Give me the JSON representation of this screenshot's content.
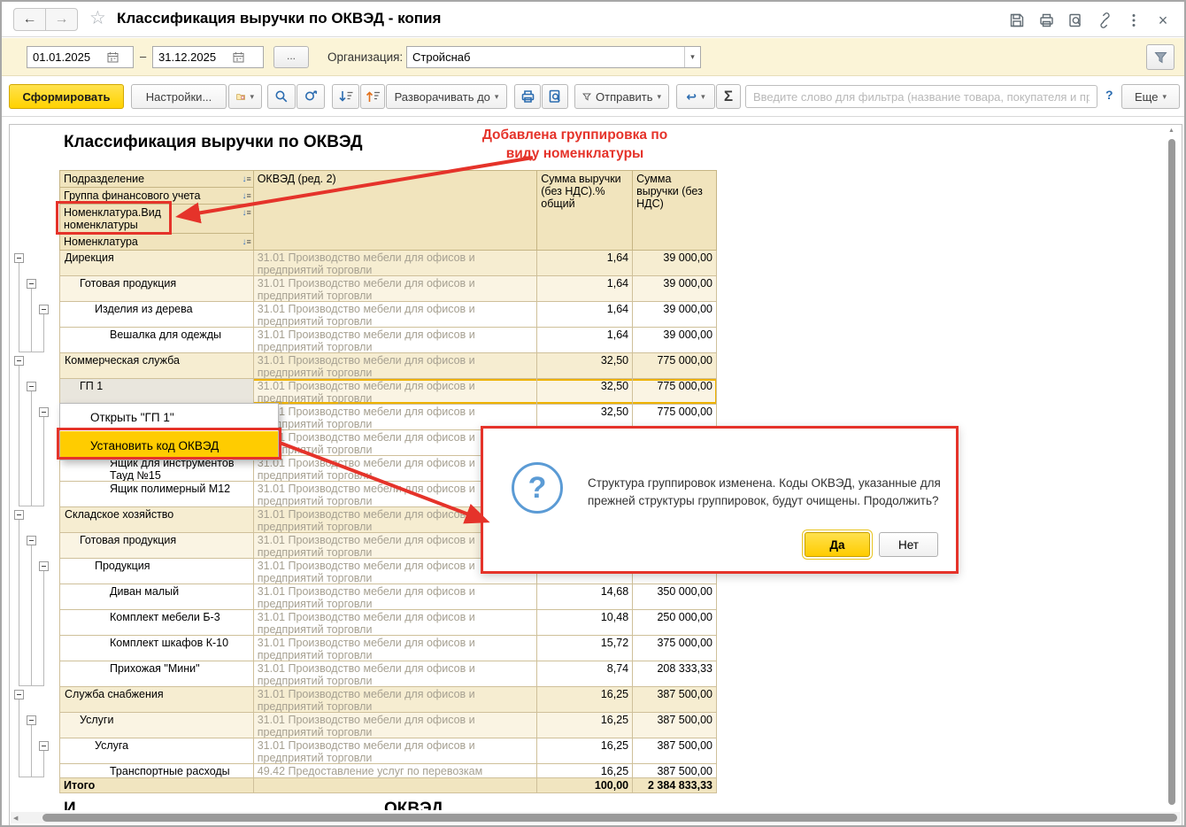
{
  "titlebar": {
    "title": "Классификация выручки по ОКВЭД - копия"
  },
  "filterbar": {
    "date_from": "01.01.2025",
    "range_dash": "–",
    "date_to": "31.12.2025",
    "period_more_label": "...",
    "org_label": "Организация:",
    "org_value": "Стройснаб"
  },
  "toolbar": {
    "generate_label": "Сформировать",
    "settings_label": "Настройки...",
    "expand_to_label": "Разворачивать до",
    "send_label": "Отправить",
    "sigma_label": "Σ",
    "filter_placeholder": "Введите слово для фильтра (название товара, покупателя и пр.)",
    "help_label": "?",
    "more_label": "Еще"
  },
  "report": {
    "title": "Классификация выручки по ОКВЭД",
    "annotation_line1": "Добавлена группировка по",
    "annotation_line2": "виду номенклатуры",
    "header": {
      "row_labels": [
        "Подразделение",
        "Группа финансового учета",
        "Номенклатура.Вид номенклатуры",
        "Номенклатура"
      ],
      "col_okved": "ОКВЭД (ред. 2)",
      "col_percent": "Сумма выручки (без НДС).% общий",
      "col_sum": "Сумма выручки (без НДС)"
    },
    "rows": [
      {
        "name": "Дирекция",
        "level": 0,
        "okved": "31.01 Производство мебели для офисов и предприятий торговли",
        "pct": "1,64",
        "sum": "39 000,00"
      },
      {
        "name": "Готовая продукция",
        "level": 1,
        "okved": "31.01 Производство мебели для офисов и предприятий торговли",
        "pct": "1,64",
        "sum": "39 000,00"
      },
      {
        "name": "Изделия из дерева",
        "level": 2,
        "okved": "31.01 Производство мебели для офисов и предприятий торговли",
        "pct": "1,64",
        "sum": "39 000,00"
      },
      {
        "name": "Вешалка для одежды",
        "level": 3,
        "okved": "31.01 Производство мебели для офисов и предприятий торговли",
        "pct": "1,64",
        "sum": "39 000,00"
      },
      {
        "name": "Коммерческая служба",
        "level": 0,
        "okved": "31.01 Производство мебели для офисов и предприятий торговли",
        "pct": "32,50",
        "sum": "775 000,00"
      },
      {
        "name": "ГП 1",
        "level": 1,
        "okved": "31.01 Производство мебели для офисов и предприятий торговли",
        "pct": "32,50",
        "sum": "775 000,00",
        "selected": true
      },
      {
        "name": "",
        "level": 2,
        "okved": "31.01 Производство мебели для офисов и предприятий торговли",
        "pct": "32,50",
        "sum": "775 000,00"
      },
      {
        "name": "",
        "level": 3,
        "okved": "31.01 Производство мебели для офисов и предприятий торговли",
        "pct": "",
        "sum": ""
      },
      {
        "name": "Ящик для инструментов Тауд №15",
        "level": 3,
        "okved": "31.01 Производство мебели для офисов и предприятий торговли",
        "pct": "",
        "sum": ""
      },
      {
        "name": "Ящик полимерный М12",
        "level": 3,
        "okved": "31.01 Производство мебели для офисов и предприятий торговли",
        "pct": "",
        "sum": ""
      },
      {
        "name": "Складское хозяйство",
        "level": 0,
        "okved": "31.01 Производство мебели для офисов и предприятий торговли",
        "pct": "",
        "sum": ""
      },
      {
        "name": "Готовая продукция",
        "level": 1,
        "okved": "31.01 Производство мебели для офисов и предприятий торговли",
        "pct": "",
        "sum": ""
      },
      {
        "name": "Продукция",
        "level": 2,
        "okved": "31.01 Производство мебели для офисов и предприятий торговли",
        "pct": "",
        "sum": ""
      },
      {
        "name": "Диван малый",
        "level": 3,
        "okved": "31.01 Производство мебели для офисов и предприятий торговли",
        "pct": "14,68",
        "sum": "350 000,00"
      },
      {
        "name": "Комплект мебели Б-3",
        "level": 3,
        "okved": "31.01 Производство мебели для офисов и предприятий торговли",
        "pct": "10,48",
        "sum": "250 000,00"
      },
      {
        "name": "Комплект шкафов К-10",
        "level": 3,
        "okved": "31.01 Производство мебели для офисов и предприятий торговли",
        "pct": "15,72",
        "sum": "375 000,00"
      },
      {
        "name": "Прихожая \"Мини\"",
        "level": 3,
        "okved": "31.01 Производство мебели для офисов и предприятий торговли",
        "pct": "8,74",
        "sum": "208 333,33"
      },
      {
        "name": "Служба снабжения",
        "level": 0,
        "okved": "31.01 Производство мебели для офисов и предприятий торговли",
        "pct": "16,25",
        "sum": "387 500,00"
      },
      {
        "name": "Услуги",
        "level": 1,
        "okved": "31.01 Производство мебели для офисов и предприятий торговли",
        "pct": "16,25",
        "sum": "387 500,00"
      },
      {
        "name": "Услуга",
        "level": 2,
        "okved": "31.01 Производство мебели для офисов и предприятий торговли",
        "pct": "16,25",
        "sum": "387 500,00"
      },
      {
        "name": "Транспортные расходы",
        "level": 3,
        "okved": "49.42 Предоставление услуг по перевозкам",
        "pct": "16,25",
        "sum": "387 500,00",
        "h": 16
      }
    ],
    "total": {
      "name": "Итого",
      "okved": "",
      "pct": "100,00",
      "sum": "2 384 833,33"
    },
    "clipped_next_left": "И",
    "clipped_next_right": "ОКВЭД"
  },
  "context_menu": {
    "items": [
      {
        "label": "Открыть \"ГП 1\""
      },
      {
        "label": "Установить код ОКВЭД",
        "highlighted": true
      }
    ]
  },
  "dialog": {
    "message": "Структура группировок изменена. Коды ОКВЭД, указанные для прежней структуры группировок, будут очищены. Продолжить?",
    "yes_label": "Да",
    "no_label": "Нет"
  },
  "colors": {
    "accent_yellow": "#ffd200",
    "menu_highlight": "#ffcc00",
    "annotation_red": "#e5332a",
    "header_bg": "#f1e4bd",
    "group_row_bg": "#f6edd1",
    "subgroup_row_bg": "#faf4e3",
    "grid_line": "#cfc09a",
    "okved_text": "#a6a091",
    "dialog_icon_blue": "#5b9bd5",
    "toolbar_icon_blue": "#2b6cb0",
    "filterbar_bg": "#fbf4d7"
  }
}
